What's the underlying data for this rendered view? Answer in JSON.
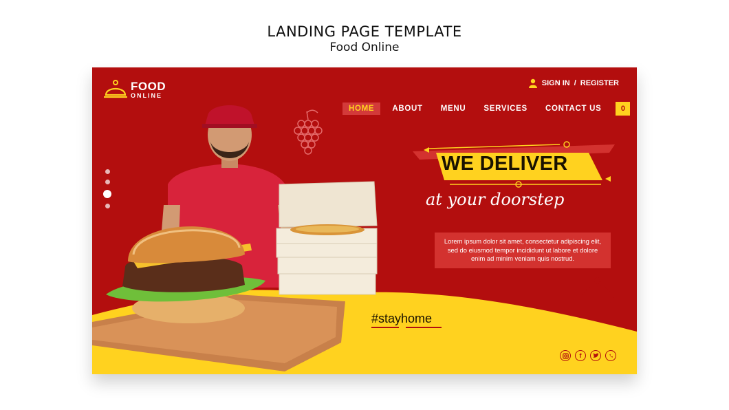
{
  "header": {
    "title": "LANDING PAGE TEMPLATE",
    "subtitle": "Food Online"
  },
  "logo": {
    "line1": "FOOD",
    "line2": "ONLINE",
    "icon": "cloche-icon"
  },
  "auth": {
    "signin": "SIGN IN",
    "separator": "/",
    "register": "REGISTER",
    "icon": "user-icon"
  },
  "nav": {
    "items": [
      {
        "label": "HOME",
        "active": true
      },
      {
        "label": "ABOUT",
        "active": false
      },
      {
        "label": "MENU",
        "active": false
      },
      {
        "label": "SERVICES",
        "active": false
      },
      {
        "label": "CONTACT US",
        "active": false
      }
    ],
    "cart_count": "0"
  },
  "hero": {
    "headline": "WE DELIVER",
    "tagline": "at your doorstep",
    "body_lines": [
      "Lorem ipsum dolor sit amet, consectetur adipiscing elit,",
      "sed do eiusmod tempor incididunt ut labore et dolore",
      "enim ad minim veniam quis nostrud."
    ],
    "hashtag": "#stayhome"
  },
  "socials": [
    "instagram-icon",
    "facebook-icon",
    "twitter-icon",
    "whatsapp-icon"
  ],
  "colors": {
    "primary": "#b30e0e",
    "accent": "#ffd21f",
    "text_dark": "#1a1200"
  }
}
